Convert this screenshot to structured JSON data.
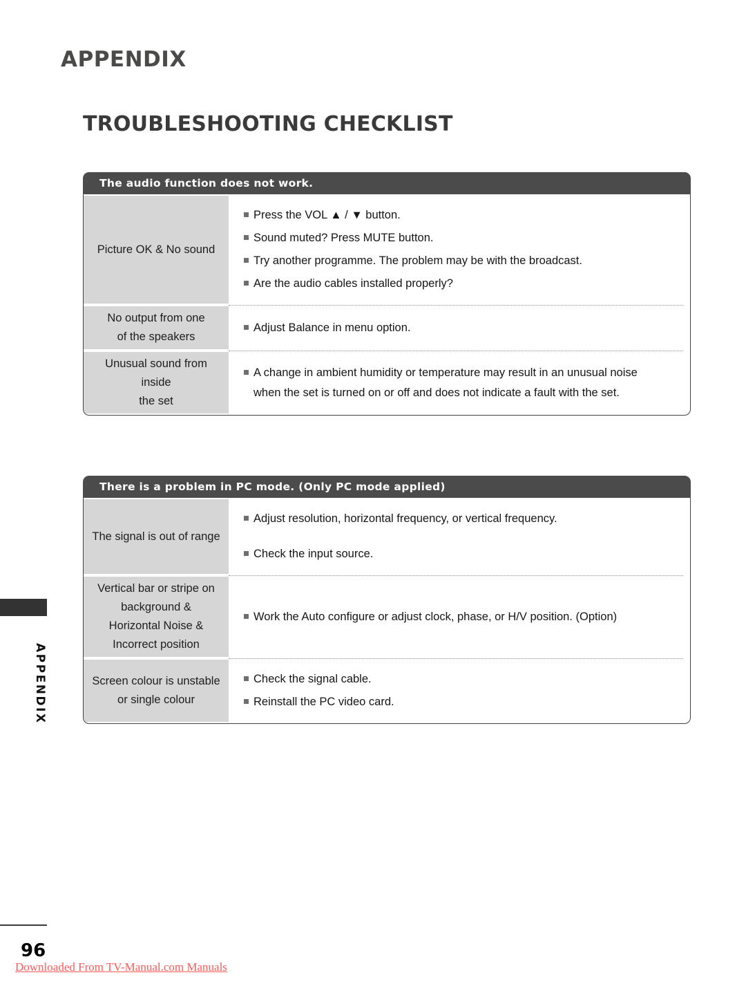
{
  "page": {
    "title": "APPENDIX",
    "section_title": "TROUBLESHOOTING CHECKLIST",
    "side_tab_label": "APPENDIX",
    "page_number": "96",
    "download_note": "Downloaded From TV-Manual.com Manuals",
    "colors": {
      "header_bar": "#4b4b4b",
      "label_cell": "#d6d6d6",
      "title_text": "#4a4a48",
      "note_text": "#ff5a5a",
      "bullet": "#6e6e6e"
    }
  },
  "tables": [
    {
      "header": "The audio function does not work.",
      "rows": [
        {
          "label_lines": [
            "Picture OK & No sound"
          ],
          "items": [
            {
              "text": "Press the VOL ▲ / ▼ button.",
              "bullet": true
            },
            {
              "text": "Sound muted? Press MUTE button.",
              "bullet": true
            },
            {
              "text": "Try another programme. The problem may be with the broadcast.",
              "bullet": true
            },
            {
              "text": "Are the audio cables installed properly?",
              "bullet": true
            }
          ]
        },
        {
          "label_lines": [
            "No output from one",
            "of the speakers"
          ],
          "items": [
            {
              "text": "Adjust Balance in menu option.",
              "bullet": true
            }
          ]
        },
        {
          "label_lines": [
            "Unusual sound from",
            "inside",
            "the set"
          ],
          "items": [
            {
              "text": "A change in ambient humidity or temperature may result in an unusual noise",
              "bullet": true
            },
            {
              "text": "when the set is turned on or off and does not indicate a fault with the set.",
              "bullet": false
            }
          ]
        }
      ]
    },
    {
      "header": "There is a problem in PC mode. (Only PC mode applied)",
      "rows": [
        {
          "label_lines": [
            "The signal is out of range"
          ],
          "items": [
            {
              "text": "Adjust resolution, horizontal frequency, or vertical frequency.",
              "bullet": true
            },
            {
              "text": "",
              "bullet": false
            },
            {
              "text": "Check the input source.",
              "bullet": true
            }
          ]
        },
        {
          "label_lines": [
            "Vertical bar or stripe on",
            "background &",
            "Horizontal Noise &",
            "Incorrect position"
          ],
          "items": [
            {
              "text": "Work the Auto configure or adjust clock, phase, or H/V position. (Option)",
              "bullet": true
            }
          ]
        },
        {
          "label_lines": [
            "Screen colour is unstable",
            "or single colour"
          ],
          "items": [
            {
              "text": "Check the signal cable.",
              "bullet": true
            },
            {
              "text": "Reinstall the PC video card.",
              "bullet": true
            }
          ]
        }
      ]
    }
  ]
}
